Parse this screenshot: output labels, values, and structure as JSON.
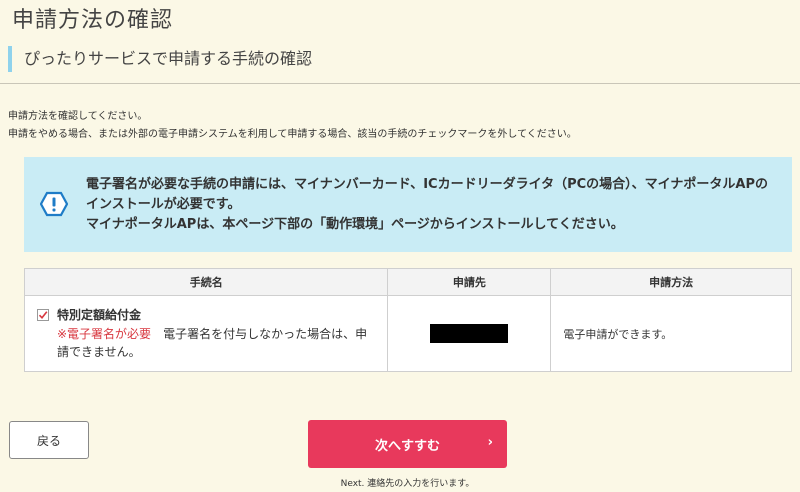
{
  "page": {
    "title": "申請方法の確認",
    "section_heading": "ぴったりサービスで申請する手続の確認"
  },
  "intro": {
    "line1": "申請方法を確認してください。",
    "line2": "申請をやめる場合、または外部の電子申請システムを利用して申請する場合、該当の手続のチェックマークを外してください。"
  },
  "notice": {
    "icon": "warning-icon",
    "line1": "電子署名が必要な手続の申請には、マイナンバーカード、ICカードリーダライタ（PCの場合）、マイナポータルAPのインストールが必要です。",
    "line2": "マイナポータルAPは、本ページ下部の「動作環境」ページからインストールしてください。"
  },
  "table": {
    "headers": [
      "手続名",
      "申請先",
      "申請方法"
    ],
    "rows": [
      {
        "checked": true,
        "name": "特別定額給付金",
        "signature_required": "※電子署名が必要",
        "signature_note": "電子署名を付与しなかった場合は、申請できません。",
        "destination": "",
        "method": "電子申請ができます。"
      }
    ]
  },
  "buttons": {
    "back": "戻る",
    "next": "次へすすむ",
    "next_arrow": "›",
    "next_note": "Next. 連絡先の入力を行います。"
  },
  "colors": {
    "background": "#fbf8e6",
    "accent_bar": "#8fd2ec",
    "notice_bg": "#c9ecf5",
    "next_button": "#e8395c",
    "required_text": "#d8373f"
  }
}
